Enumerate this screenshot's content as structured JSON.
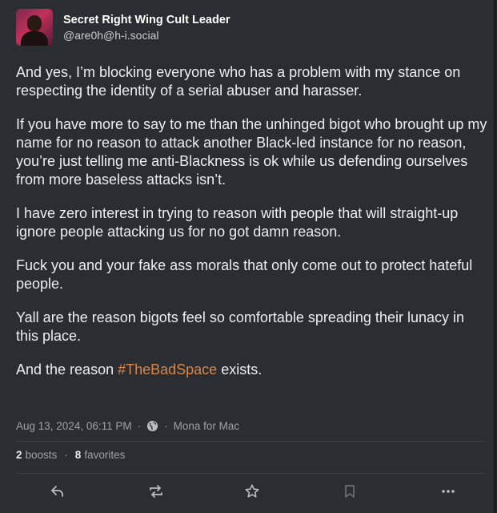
{
  "author": {
    "display_name": "Secret Right Wing Cult Leader",
    "handle": "@are0h@h-i.social"
  },
  "content": {
    "p1": "And yes, I’m blocking everyone who has a problem with my stance on respecting the identity of a serial abuser and harasser.",
    "p2": "If you have more to say to me than the unhinged bigot who brought up my name for no reason to attack another Black-led instance for no reason, you’re just telling me anti-Blackness is ok while us defending ourselves from more baseless attacks isn’t.",
    "p3": "I have zero interest in trying to reason with people that will straight-up ignore people attacking us for no got damn reason.",
    "p4": "Fuck you and your fake ass morals that only come out to protect hateful people.",
    "p5": "Yall are the reason bigots feel so comfortable spreading their lunacy in this place.",
    "p6_before": "And the reason ",
    "p6_hashtag": "#TheBadSpace",
    "p6_after": " exists."
  },
  "meta": {
    "timestamp": "Aug 13, 2024, 06:11 PM",
    "separator": "·",
    "visibility_icon": "globe-icon",
    "client": "Mona for Mac"
  },
  "stats": {
    "boosts_count": "2",
    "boosts_label": "boosts",
    "favorites_count": "8",
    "favorites_label": "favorites"
  },
  "actions": {
    "icons": [
      "reply-icon",
      "boost-icon",
      "favorite-icon",
      "bookmark-icon",
      "more-icon"
    ]
  },
  "colors": {
    "background": "#2a2d31",
    "hashtag": "#d9864a",
    "muted_text": "#9da1a8"
  }
}
